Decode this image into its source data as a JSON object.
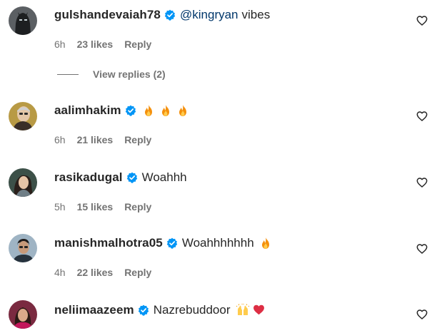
{
  "comments": [
    {
      "username": "gulshandevaiah78",
      "mention": "@kingryan",
      "text": "vibes",
      "time": "6h",
      "likes": "23 likes",
      "reply": "Reply",
      "view_replies": "View replies (2)",
      "emojis": []
    },
    {
      "username": "aalimhakim",
      "text": "",
      "time": "6h",
      "likes": "21 likes",
      "reply": "Reply",
      "emojis": [
        "fire-icon",
        "fire-icon",
        "fire-icon"
      ]
    },
    {
      "username": "rasikadugal",
      "text": "Woahhh",
      "time": "5h",
      "likes": "15 likes",
      "reply": "Reply",
      "emojis": []
    },
    {
      "username": "manishmalhotra05",
      "text": "Woahhhhhhh",
      "time": "4h",
      "likes": "22 likes",
      "reply": "Reply",
      "emojis": [
        "fire-icon"
      ]
    },
    {
      "username": "neliimaazeem",
      "text": "Nazrebuddoor",
      "emojis": [
        "raising-hands-icon",
        "red-heart-icon"
      ]
    }
  ],
  "colors": {
    "verified": "#0095f6",
    "mention": "#00376b",
    "meta": "#737373",
    "text": "#262626",
    "heart": "#ed4956"
  }
}
